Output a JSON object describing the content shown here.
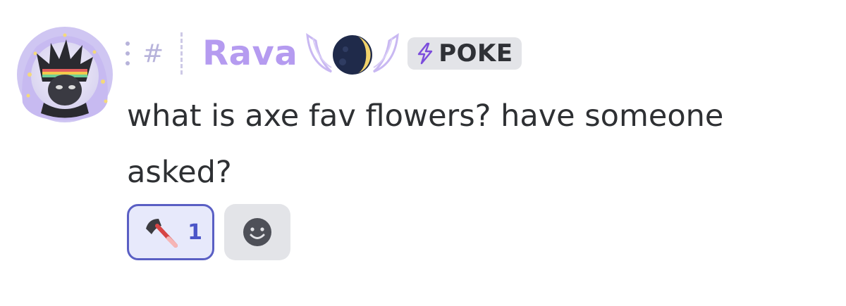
{
  "message": {
    "username": "Rava",
    "tag_label": "POKE",
    "role_hash": "#",
    "text": "what is axe fav flowers? have someone asked?"
  },
  "reactions": [
    {
      "icon": "axe-icon",
      "count": "1",
      "selected": true
    }
  ],
  "colors": {
    "username": "#b59bf0",
    "reaction_border": "#5a5fc4",
    "reaction_bg": "#e7e9fb",
    "tag_bg": "#e3e4e8"
  }
}
